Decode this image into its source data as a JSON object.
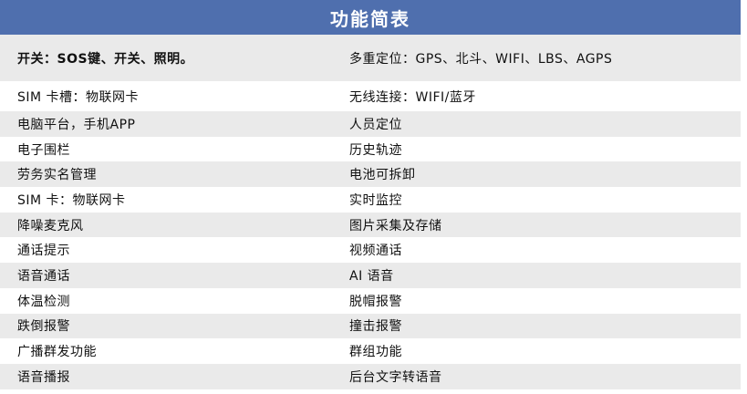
{
  "header": {
    "title": "功能简表"
  },
  "rows": [
    {
      "left": "开关：SOS键、开关、照明。",
      "right": "多重定位：GPS、北斗、WIFI、LBS、AGPS"
    },
    {
      "left": "SIM 卡槽：物联网卡",
      "right": "无线连接：WIFI/蓝牙"
    },
    {
      "left": "电脑平台，手机APP",
      "right": "人员定位"
    },
    {
      "left": "电子围栏",
      "right": "历史轨迹"
    },
    {
      "left": "劳务实名管理",
      "right": "电池可拆卸"
    },
    {
      "left": "SIM 卡：物联网卡",
      "right": "实时监控"
    },
    {
      "left": "降噪麦克风",
      "right": "图片采集及存储"
    },
    {
      "left": "通话提示",
      "right": "视频通话"
    },
    {
      "left": "语音通话",
      "right": "AI 语音"
    },
    {
      "left": "体温检测",
      "right": "脱帽报警"
    },
    {
      "left": "跌倒报警",
      "right": "撞击报警"
    },
    {
      "left": "广播群发功能",
      "right": "群组功能"
    },
    {
      "left": "语音播报",
      "right": "后台文字转语音"
    }
  ]
}
